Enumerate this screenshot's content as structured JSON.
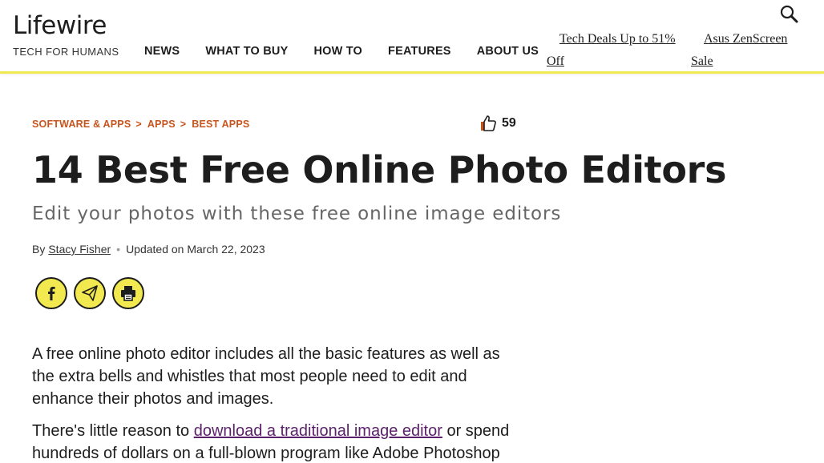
{
  "header": {
    "logo": "Lifewire",
    "tagline": "TECH FOR HUMANS",
    "nav": [
      "NEWS",
      "WHAT TO BUY",
      "HOW TO",
      "FEATURES",
      "ABOUT US"
    ],
    "promos": [
      "Tech Deals Up to 51% Off",
      "Asus ZenScreen Sale"
    ],
    "accent_color": "#f2e84f"
  },
  "breadcrumb": [
    "SOFTWARE & APPS",
    "APPS",
    "BEST APPS"
  ],
  "breadcrumb_sep": ">",
  "likes": {
    "count": "59"
  },
  "article": {
    "title": "14 Best Free Online Photo Editors",
    "subtitle": "Edit your photos with these free online image editors",
    "by": "By",
    "author": "Stacy Fisher",
    "updated": "Updated on March 22, 2023",
    "para1": "A free online photo editor includes all the basic features as well as the extra bells and whistles that most people need to edit and enhance their photos and images.",
    "para2_before": "There's little reason to ",
    "para2_link": "download a traditional image editor",
    "para2_after": " or spend hundreds of dollars on a full-blown program like Adobe Photoshop"
  },
  "share": {
    "icons": [
      "facebook-icon",
      "email-icon",
      "print-icon"
    ]
  }
}
